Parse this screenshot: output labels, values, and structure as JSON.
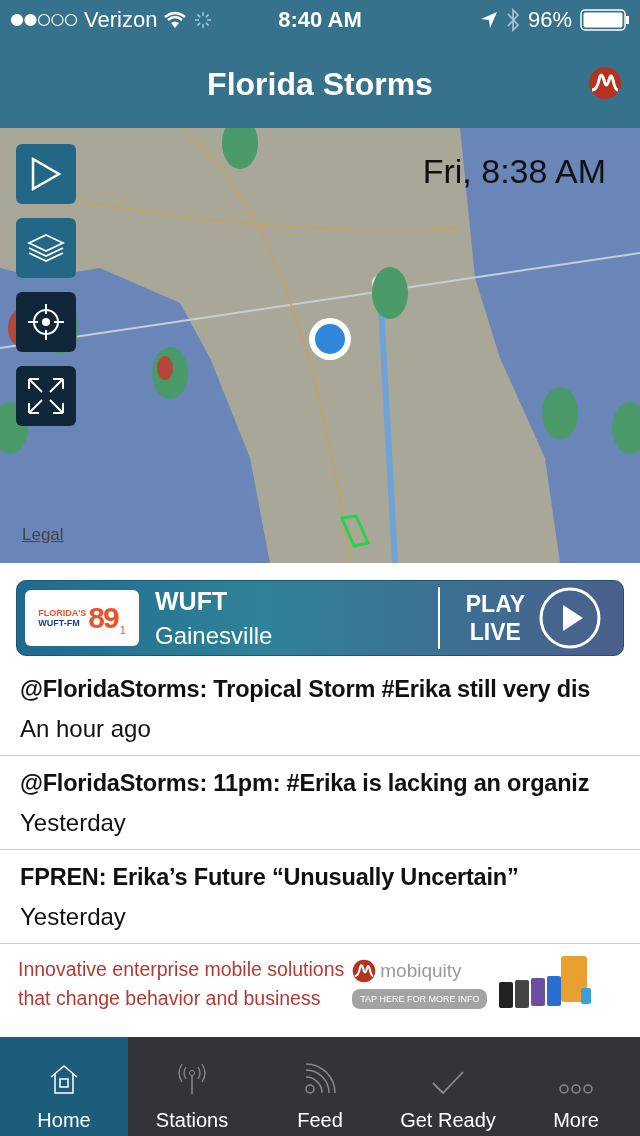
{
  "status_bar": {
    "carrier": "Verizon",
    "time": "8:40 AM",
    "battery": "96%"
  },
  "nav_bar": {
    "title": "Florida Storms"
  },
  "map": {
    "kind": "picture",
    "timestamp": "Fri, 8:38 AM",
    "legal_link": "Legal"
  },
  "station": {
    "logo": {
      "line1": "FLORIDA'S",
      "line2": "WUFT-FM",
      "number": "89",
      "decimal": "1"
    },
    "name": "WUFT",
    "city": "Gainesville",
    "play_label_1": "PLAY",
    "play_label_2": "LIVE"
  },
  "news": [
    {
      "title": "@FloridaStorms: Tropical Storm #Erika still very dis",
      "time": "An hour ago"
    },
    {
      "title": "@FloridaStorms: 11pm: #Erika is lacking an organiz",
      "time": "Yesterday"
    },
    {
      "title": "FPREN: Erika’s Future “Unusually Uncertain”",
      "time": "Yesterday"
    }
  ],
  "ad": {
    "line1": "Innovative enterprise mobile solutions",
    "line2": "that change behavior and business",
    "brand": "mobiquity",
    "button": "TAP HERE FOR MORE INFO"
  },
  "tab_bar": [
    {
      "kind": "home",
      "label": "Home",
      "selected": true
    },
    {
      "kind": "stations",
      "label": "Stations",
      "selected": false
    },
    {
      "kind": "feed",
      "label": "Feed",
      "selected": false
    },
    {
      "kind": "check",
      "label": "Get Ready",
      "selected": false
    },
    {
      "kind": "more",
      "label": "More",
      "selected": false
    }
  ]
}
